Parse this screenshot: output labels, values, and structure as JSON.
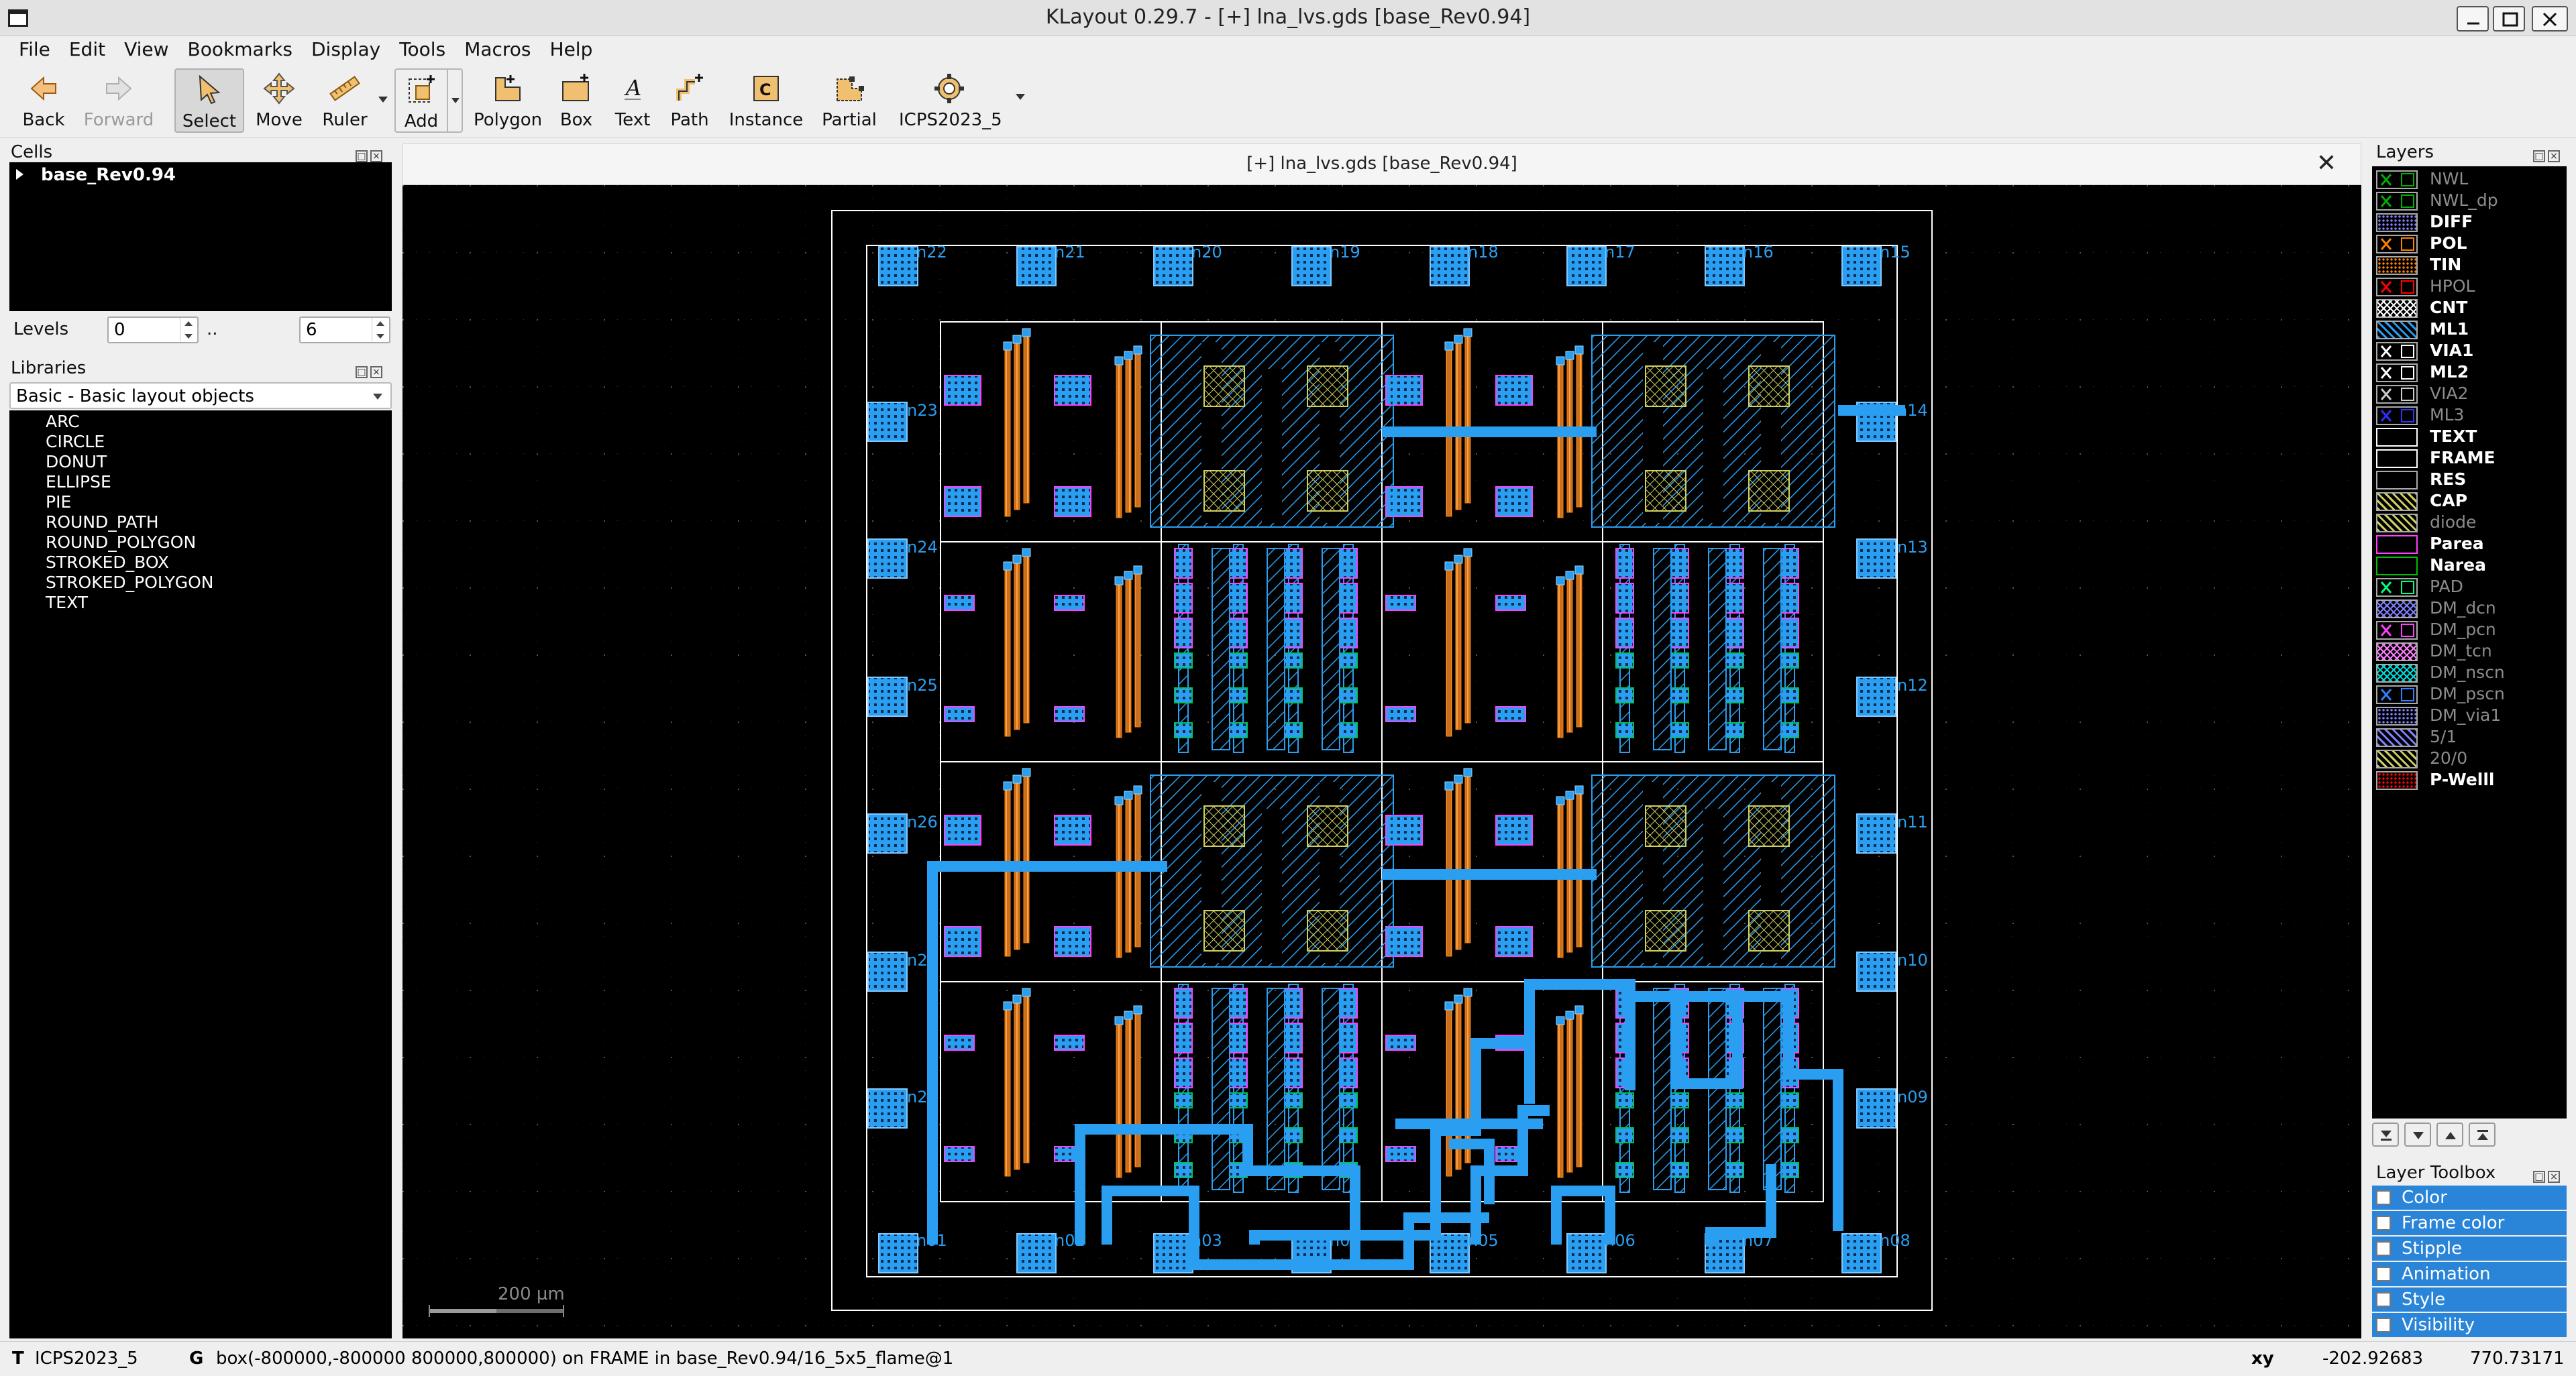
{
  "window": {
    "title": "KLayout 0.29.7 - [+] lna_lvs.gds [base_Rev0.94]"
  },
  "menu": [
    "File",
    "Edit",
    "View",
    "Bookmarks",
    "Display",
    "Tools",
    "Macros",
    "Help"
  ],
  "toolbar": {
    "back": "Back",
    "forward": "Forward",
    "select": "Select",
    "move": "Move",
    "ruler": "Ruler",
    "add": "Add",
    "polygon": "Polygon",
    "box": "Box",
    "text": "Text",
    "path": "Path",
    "instance": "Instance",
    "partial": "Partial",
    "tech": "ICPS2023_5"
  },
  "cells": {
    "title": "Cells",
    "root": "base_Rev0.94",
    "levels_label": "Levels",
    "levels_from": "0",
    "levels_sep": "..",
    "levels_to": "6"
  },
  "libraries": {
    "title": "Libraries",
    "selected": "Basic - Basic layout objects",
    "items": [
      "ARC",
      "CIRCLE",
      "DONUT",
      "ELLIPSE",
      "PIE",
      "ROUND_PATH",
      "ROUND_POLYGON",
      "STROKED_BOX",
      "STROKED_POLYGON",
      "TEXT"
    ]
  },
  "view": {
    "tab_title": "[+] lna_lvs.gds [base_Rev0.94]",
    "scale_label": "200 µm",
    "pad_labels": [
      "n22",
      "n21",
      "n20",
      "n19",
      "n18",
      "n17",
      "n16",
      "n15",
      "n23",
      "n14",
      "n24",
      "n13",
      "n25",
      "n12",
      "n26",
      "n11",
      "n27",
      "n10",
      "n28",
      "n09",
      "n01",
      "n02",
      "n03",
      "n04",
      "n05",
      "n06",
      "n07",
      "n08"
    ]
  },
  "layers": {
    "title": "Layers",
    "items": [
      {
        "name": "NWL",
        "visible": false,
        "color": "#00b000",
        "icon": "cross-icon"
      },
      {
        "name": "NWL_dp",
        "visible": false,
        "color": "#00b000",
        "icon": "cross-icon"
      },
      {
        "name": "DIFF",
        "visible": true,
        "color": "#8080ff",
        "icon": "dots-icon"
      },
      {
        "name": "POL",
        "visible": true,
        "color": "#ff8000",
        "icon": "cross-icon"
      },
      {
        "name": "TIN",
        "visible": true,
        "color": "#ff8000",
        "icon": "dots-icon"
      },
      {
        "name": "HPOL",
        "visible": false,
        "color": "#ff0000",
        "icon": "cross-icon"
      },
      {
        "name": "CNT",
        "visible": true,
        "color": "#ffffff",
        "icon": "cross-hatch-icon"
      },
      {
        "name": "ML1",
        "visible": true,
        "color": "#2a9ef0",
        "icon": "diagonal-icon"
      },
      {
        "name": "VIA1",
        "visible": true,
        "color": "#ffffff",
        "icon": "cross-icon"
      },
      {
        "name": "ML2",
        "visible": true,
        "color": "#ffffff",
        "icon": "cross-icon"
      },
      {
        "name": "VIA2",
        "visible": false,
        "color": "#cccccc",
        "icon": "cross-icon"
      },
      {
        "name": "ML3",
        "visible": false,
        "color": "#3030ff",
        "icon": "cross-icon"
      },
      {
        "name": "TEXT",
        "visible": true,
        "color": "#ffffff",
        "icon": "outline-icon"
      },
      {
        "name": "FRAME",
        "visible": true,
        "color": "#ffffff",
        "icon": "outline-icon"
      },
      {
        "name": "RES",
        "visible": true,
        "color": "#000000",
        "icon": "blank-icon"
      },
      {
        "name": "CAP",
        "visible": true,
        "color": "#d0d060",
        "icon": "diagonal-icon"
      },
      {
        "name": "diode",
        "visible": false,
        "color": "#d0d060",
        "icon": "diagonal-icon"
      },
      {
        "name": "Parea",
        "visible": true,
        "color": "#ff40ff",
        "icon": "outline-icon"
      },
      {
        "name": "Narea",
        "visible": true,
        "color": "#00c000",
        "icon": "outline-icon"
      },
      {
        "name": "PAD",
        "visible": false,
        "color": "#00ff80",
        "icon": "cross-icon"
      },
      {
        "name": "DM_dcn",
        "visible": false,
        "color": "#8080ff",
        "icon": "cross-hatch-icon"
      },
      {
        "name": "DM_pcn",
        "visible": false,
        "color": "#ff40ff",
        "icon": "cross-icon"
      },
      {
        "name": "DM_tcn",
        "visible": false,
        "color": "#ff80ff",
        "icon": "cross-hatch-icon"
      },
      {
        "name": "DM_nscn",
        "visible": false,
        "color": "#00e0e0",
        "icon": "cross-hatch-icon"
      },
      {
        "name": "DM_pscn",
        "visible": false,
        "color": "#3080ff",
        "icon": "cross-icon"
      },
      {
        "name": "DM_via1",
        "visible": false,
        "color": "#8080ff",
        "icon": "dots-icon"
      },
      {
        "name": "5/1",
        "visible": false,
        "color": "#8080ff",
        "icon": "diagonal-icon"
      },
      {
        "name": "20/0",
        "visible": false,
        "color": "#d0d060",
        "icon": "diagonal-icon"
      },
      {
        "name": "P-Welll",
        "visible": true,
        "color": "#ff0000",
        "icon": "dots-icon"
      }
    ]
  },
  "layer_toolbox": {
    "title": "Layer Toolbox",
    "items": [
      "Color",
      "Frame color",
      "Stipple",
      "Animation",
      "Style",
      "Visibility"
    ]
  },
  "status": {
    "tech_prefix": "T",
    "tech": "ICPS2023_5",
    "grid_prefix": "G",
    "message": "box(-800000,-800000 800000,800000) on FRAME in base_Rev0.94/16_5x5_flame@1",
    "coord_label": "xy",
    "x": "-202.92683",
    "y": "770.73171"
  }
}
